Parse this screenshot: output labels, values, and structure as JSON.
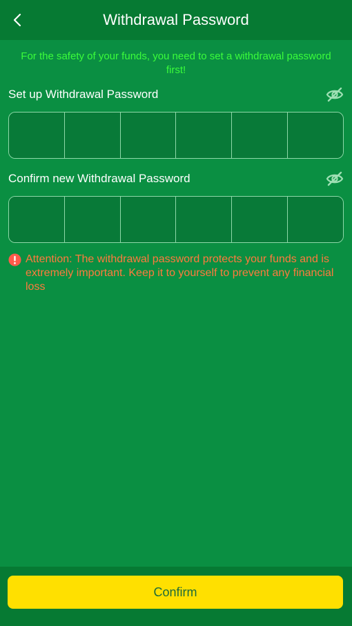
{
  "header": {
    "title": "Withdrawal Password",
    "back_icon": "chevron-left-icon"
  },
  "notice": "For the safety of your funds, you need to set a withdrawal password first!",
  "setup": {
    "label": "Set up Withdrawal Password",
    "toggle_icon": "eye-off-icon",
    "digits": 6
  },
  "confirm_field": {
    "label": "Confirm new Withdrawal Password",
    "toggle_icon": "eye-off-icon",
    "digits": 6
  },
  "attention": {
    "icon": "alert-circle-icon",
    "text": "Attention: The withdrawal password protects your funds and is extremely important. Keep it to yourself to prevent any financial loss"
  },
  "footer": {
    "confirm_label": "Confirm"
  },
  "colors": {
    "background": "#0a8f42",
    "header": "#067a33",
    "notice": "#3bfc3b",
    "attention": "#ff7a3d",
    "button": "#ffe000",
    "button_text": "#1c6a3a"
  }
}
